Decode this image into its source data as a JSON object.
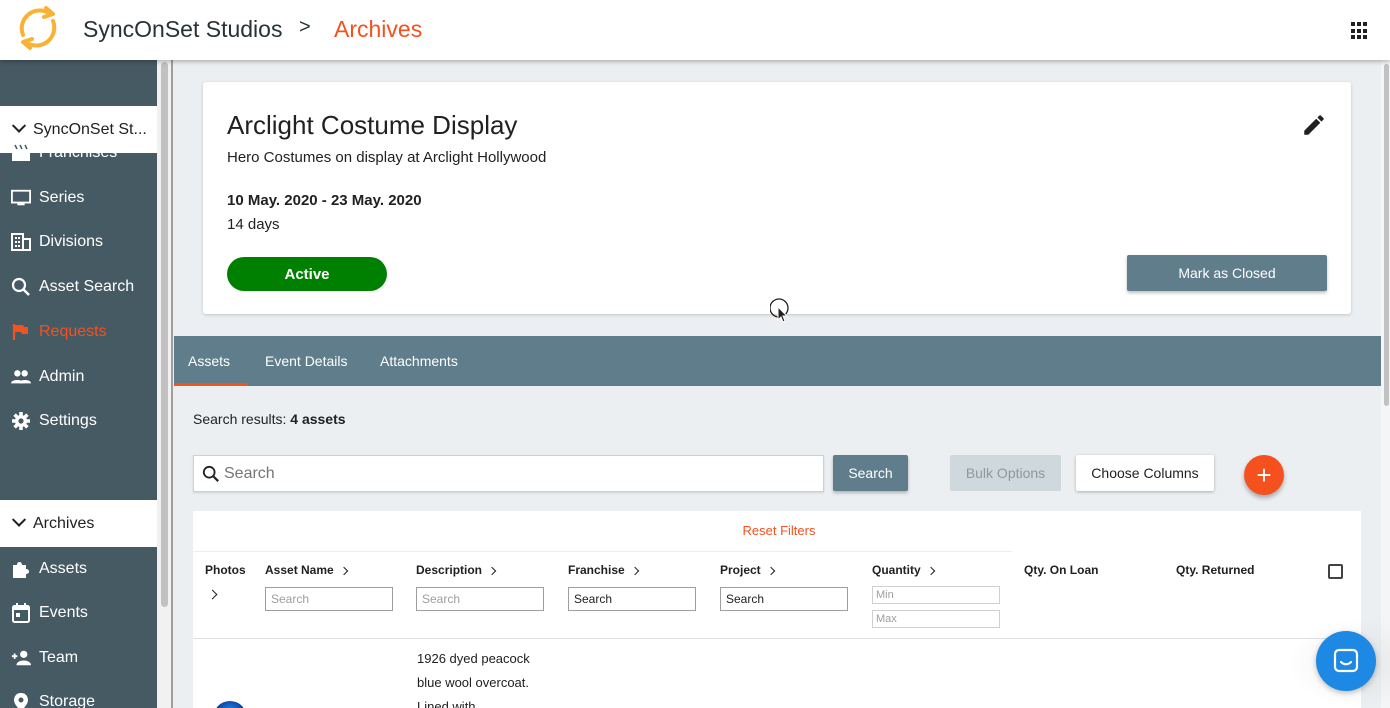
{
  "header": {
    "brand": "SyncOnSet Studios",
    "separator": ">",
    "current": "Archives",
    "accent_color": "#f4511e"
  },
  "sidebar": {
    "group_top": "SyncOnSet St...",
    "items_top": [
      {
        "label": "Franchises",
        "icon": "clapperboard-icon"
      },
      {
        "label": "Series",
        "icon": "monitor-icon"
      },
      {
        "label": "Divisions",
        "icon": "building-icon"
      },
      {
        "label": "Asset Search",
        "icon": "search-icon"
      },
      {
        "label": "Requests",
        "icon": "flag-icon"
      },
      {
        "label": "Admin",
        "icon": "people-icon"
      },
      {
        "label": "Settings",
        "icon": "gear-icon"
      }
    ],
    "group_bottom": "Archives",
    "items_bottom": [
      {
        "label": "Assets",
        "icon": "puzzle-icon"
      },
      {
        "label": "Events",
        "icon": "calendar-icon"
      },
      {
        "label": "Team",
        "icon": "add-person-icon"
      },
      {
        "label": "Storage",
        "icon": "pin-icon"
      }
    ]
  },
  "event": {
    "title": "Arclight Costume Display",
    "subtitle": "Hero Costumes on display at Arclight Hollywood",
    "dates": "10 May. 2020 - 23 May. 2020",
    "duration": "14 days",
    "status": "Active",
    "status_color": "#008000",
    "close_label": "Mark as Closed"
  },
  "tabs": [
    "Assets",
    "Event Details",
    "Attachments"
  ],
  "results": {
    "prefix": "Search results: ",
    "count": "4 assets"
  },
  "toolbar": {
    "search_placeholder": "Search",
    "search_button": "Search",
    "bulk_button": "Bulk Options",
    "columns_button": "Choose Columns",
    "add_button": "+"
  },
  "table": {
    "reset_filters": "Reset Filters",
    "columns": {
      "photos": "Photos",
      "asset_name": "Asset Name",
      "description": "Description",
      "franchise": "Franchise",
      "project": "Project",
      "quantity": "Quantity",
      "qty_on_loan": "Qty. On Loan",
      "qty_returned": "Qty. Returned"
    },
    "filters": {
      "asset_name": "Search",
      "description": "Search",
      "franchise": "Search",
      "project": "Search",
      "quantity_min": "Min",
      "quantity_max": "Max"
    },
    "rows": [
      {
        "description_lines": [
          "1926 dyed peacock",
          "blue wool overcoat.",
          "Lined with"
        ]
      }
    ]
  }
}
